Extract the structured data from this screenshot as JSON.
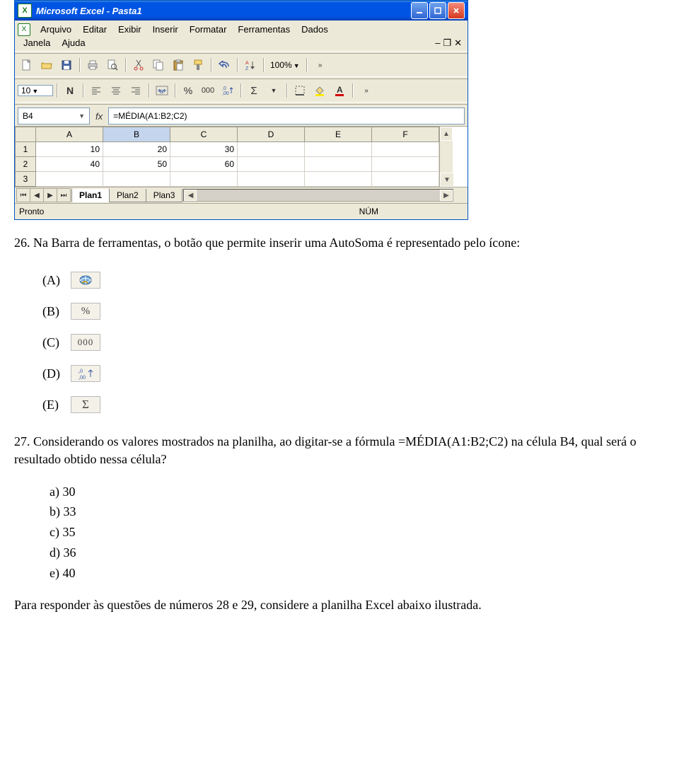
{
  "window": {
    "app_icon": "X",
    "title": "Microsoft Excel - Pasta1"
  },
  "menu": {
    "arquivo": "Arquivo",
    "editar": "Editar",
    "exibir": "Exibir",
    "inserir": "Inserir",
    "formatar": "Formatar",
    "ferramentas": "Ferramentas",
    "dados": "Dados",
    "janela": "Janela",
    "ajuda": "Ajuda"
  },
  "toolbar1": {
    "zoom": "100%"
  },
  "toolbar2": {
    "fontsize": "10",
    "bold": "N",
    "percent": "%",
    "thousands": "000",
    "sigma": "Σ"
  },
  "formula_bar": {
    "name_box": "B4",
    "fx": "fx",
    "formula": "=MÉDIA(A1:B2;C2)"
  },
  "columns": [
    "A",
    "B",
    "C",
    "D",
    "E",
    "F"
  ],
  "rows": [
    "1",
    "2",
    "3"
  ],
  "cells": {
    "r1c1": "10",
    "r1c2": "20",
    "r1c3": "30",
    "r1c4": "",
    "r1c5": "",
    "r1c6": "",
    "r2c1": "40",
    "r2c2": "50",
    "r2c3": "60",
    "r2c4": "",
    "r2c5": "",
    "r2c6": "",
    "r3c1": "",
    "r3c2": "",
    "r3c3": "",
    "r3c4": "",
    "r3c5": "",
    "r3c6": ""
  },
  "tabs": {
    "t1": "Plan1",
    "t2": "Plan2",
    "t3": "Plan3"
  },
  "status": {
    "ready": "Pronto",
    "num": "NÚM"
  },
  "q26": {
    "text": "26. Na Barra de ferramentas, o botão que permite inserir uma AutoSoma é representado pelo ícone:",
    "A": "(A)",
    "B": "(B)",
    "C": "(C)",
    "D": "(D)",
    "E": "(E)",
    "iconC": "000",
    "iconE": "Σ"
  },
  "q27": {
    "text": "27. Considerando os valores mostrados na planilha, ao digitar-se a fórmula =MÉDIA(A1:B2;C2) na célula B4, qual será o resultado obtido nessa célula?",
    "a": "a)  30",
    "b": "b)  33",
    "c": "c)  35",
    "d": "d)  36",
    "e": "e)  40"
  },
  "footer": "Para responder às questões de números 28 e 29, considere a planilha Excel abaixo ilustrada."
}
